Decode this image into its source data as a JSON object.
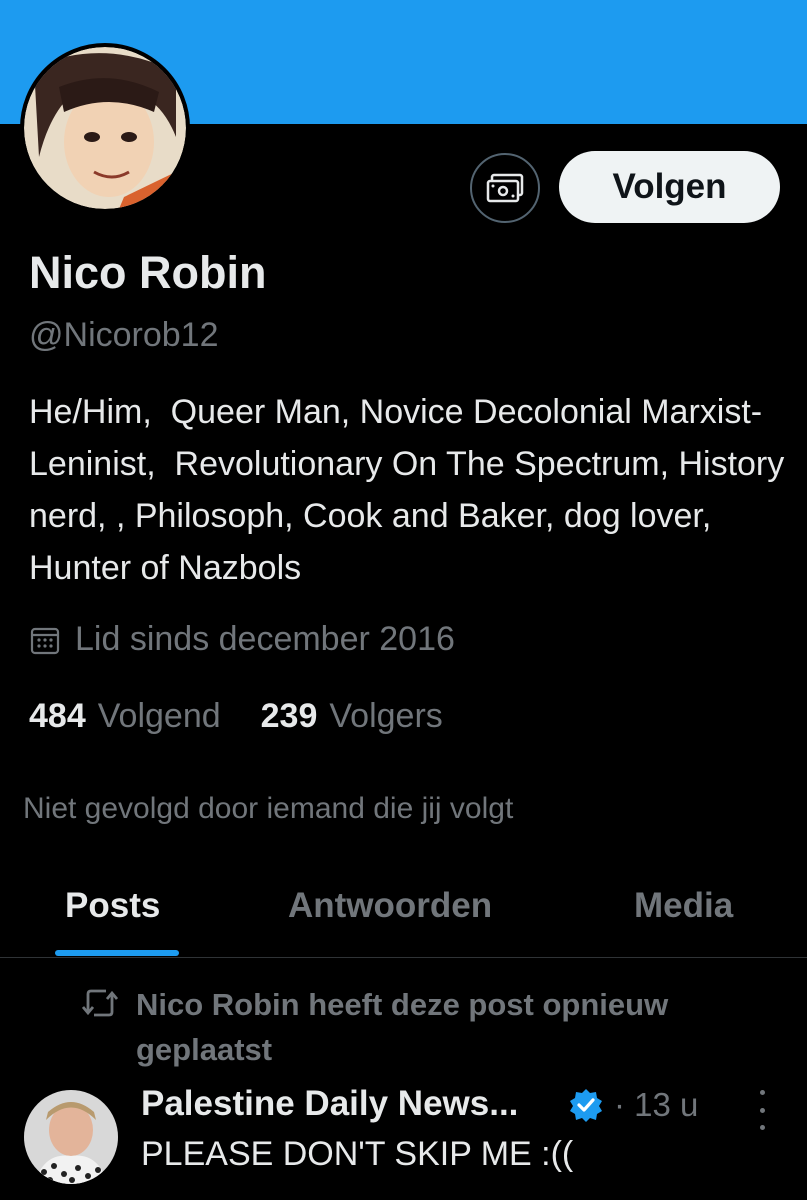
{
  "profile": {
    "name": "Nico Robin",
    "handle": "@Nicorob12",
    "bio": "He/Him,  Queer Man, Novice Decolonial Marxist-Leninist,  Revolutionary On The Spectrum, History nerd, , Philosoph, Cook and Baker, dog lover, Hunter of Nazbols",
    "joined": "Lid sinds december 2016",
    "following_count": "484",
    "following_label": "Volgend",
    "followers_count": "239",
    "followers_label": "Volgers",
    "not_followed_text": "Niet gevolgd door iemand die jij volgt"
  },
  "actions": {
    "follow_label": "Volgen",
    "subscribe_icon": "money-icon"
  },
  "tabs": [
    {
      "label": "Posts",
      "active": true
    },
    {
      "label": "Antwoorden",
      "active": false
    },
    {
      "label": "Media",
      "active": false
    }
  ],
  "post": {
    "repost_text": "Nico Robin heeft deze post opnieuw geplaatst",
    "author": "Palestine Daily News...",
    "time": "· 13 u",
    "text": "PLEASE DON'T SKIP ME :(("
  },
  "colors": {
    "banner": "#1d9bf0",
    "accent": "#1d9bf0",
    "background": "#000000",
    "secondary_text": "#71767b"
  }
}
